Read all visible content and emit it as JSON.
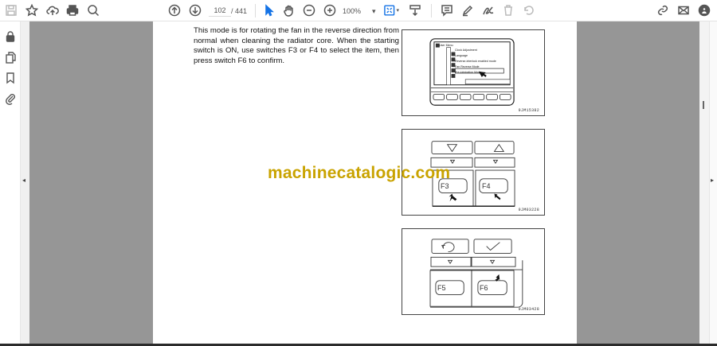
{
  "toolbar": {
    "icons": [
      "save-icon",
      "bookmark-star-icon",
      "upload-cloud-icon",
      "print-icon",
      "find-icon",
      "page-up-icon",
      "page-down-icon",
      "select-cursor-icon",
      "hand-icon",
      "zoom-out-icon",
      "zoom-in-icon",
      "fit-page-icon",
      "scroll-mode-icon",
      "comment-icon",
      "highlight-icon",
      "sign-icon",
      "delete-icon",
      "rotate-icon",
      "share-link-icon",
      "email-icon",
      "account-icon"
    ],
    "current_page": "102",
    "total_pages": "/ 441",
    "zoom_level": "100%",
    "accent": "#1473e6"
  },
  "sidebar": {
    "icons": [
      "lock-icon",
      "pages-icon",
      "bookmark-icon",
      "attachment-icon"
    ]
  },
  "document": {
    "paragraph": "This mode is for rotating the fan in the reverse direction from normal when cleaning the radiator core.  When the starting switch is ON, use switches F3 or F4 to select the item, then press switch F6 to confirm.",
    "figure1": {
      "menu_title": "User Menu",
      "items": [
        "Clock Adjustment",
        "Language",
        "Reverse-interlock enabled mode",
        "Fan Reverse Mode",
        "Pre-lubrication Mode"
      ],
      "caption": "9JM15382"
    },
    "figure2": {
      "keys": [
        "F3",
        "F4"
      ],
      "caption": "9JM03228"
    },
    "figure3": {
      "keys": [
        "F5",
        "F6"
      ],
      "caption": "9JM03428"
    },
    "watermark": "machinecatalogic.com"
  }
}
